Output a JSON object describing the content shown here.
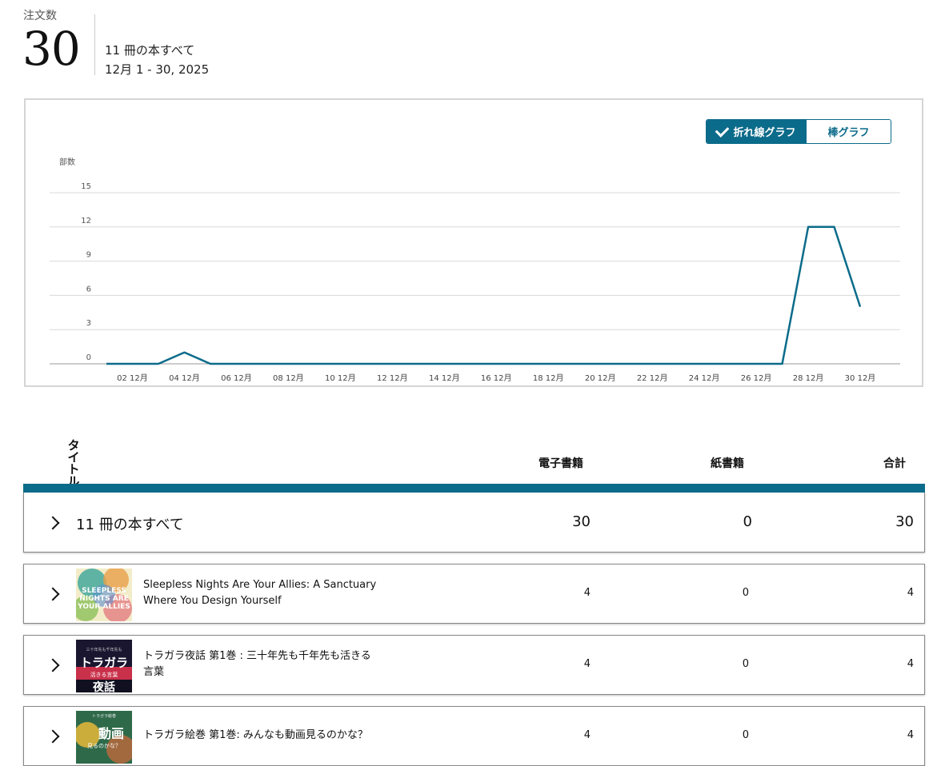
{
  "summary": {
    "label": "注文数",
    "value": "30",
    "scope": "11 冊の本すべて",
    "range": "12月 1 - 30, 2025"
  },
  "chart_toggle": {
    "line_label": "折れ線グラフ",
    "bar_label": "棒グラフ",
    "selected": "line"
  },
  "chart_data": {
    "type": "line",
    "ylabel": "部数",
    "ylim": [
      0,
      15
    ],
    "yticks": [
      0,
      3,
      6,
      9,
      12,
      15
    ],
    "x_tick_labels": [
      "02 12月",
      "04 12月",
      "06 12月",
      "08 12月",
      "10 12月",
      "12 12月",
      "14 12月",
      "16 12月",
      "18 12月",
      "20 12月",
      "22 12月",
      "24 12月",
      "26 12月",
      "28 12月",
      "30 12月"
    ],
    "x": [
      1,
      2,
      3,
      4,
      5,
      6,
      7,
      8,
      9,
      10,
      11,
      12,
      13,
      14,
      15,
      16,
      17,
      18,
      19,
      20,
      21,
      22,
      23,
      24,
      25,
      26,
      27,
      28,
      29,
      30
    ],
    "series": [
      {
        "values": [
          0,
          0,
          0,
          1,
          0,
          0,
          0,
          0,
          0,
          0,
          0,
          0,
          0,
          0,
          0,
          0,
          0,
          0,
          0,
          0,
          0,
          0,
          0,
          0,
          0,
          0,
          0,
          12,
          12,
          5
        ]
      }
    ],
    "line_color": "#0b6b8a",
    "grid": true
  },
  "table": {
    "headers": {
      "title": [
        "タ",
        "イ",
        "ト",
        "ル"
      ],
      "ebook": "電子書籍",
      "paper": "紙書籍",
      "total": "合計"
    },
    "all_row": {
      "label": "11 冊の本すべて",
      "ebook": "30",
      "paper": "0",
      "total": "30"
    },
    "books": [
      {
        "title_line1": "Sleepless Nights Are Your Allies: A Sanctuary",
        "title_line2": "Where You Design Yourself",
        "ebook": "4",
        "paper": "0",
        "total": "4",
        "cover_text": "SLEEPLESS NIGHTS ARE YOUR ALLIES"
      },
      {
        "title_line1": "トラガラ夜話 第1巻 : 三十年先も千年先も活きる",
        "title_line2": "言葉",
        "ebook": "4",
        "paper": "0",
        "total": "4",
        "cover_text": "トラガラ"
      },
      {
        "title_line1": "トラガラ絵巻 第1巻: みんなも動画見るのかな？",
        "title_line2": "",
        "ebook": "4",
        "paper": "0",
        "total": "4",
        "cover_text": "動画"
      }
    ]
  },
  "colors": {
    "accent": "#0b6b8a",
    "grid": "#d9d9d9"
  }
}
